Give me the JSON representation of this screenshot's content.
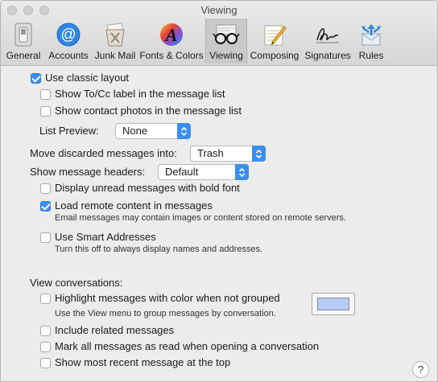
{
  "window": {
    "title": "Viewing"
  },
  "toolbar": {
    "items": [
      {
        "label": "General",
        "icon": "general-switch-icon"
      },
      {
        "label": "Accounts",
        "icon": "at-sign-icon"
      },
      {
        "label": "Junk Mail",
        "icon": "trash-bin-icon"
      },
      {
        "label": "Fonts & Colors",
        "icon": "fonts-colors-icon"
      },
      {
        "label": "Viewing",
        "icon": "eyeglasses-icon",
        "selected": true
      },
      {
        "label": "Composing",
        "icon": "pencil-paper-icon"
      },
      {
        "label": "Signatures",
        "icon": "signature-icon"
      },
      {
        "label": "Rules",
        "icon": "rules-arrows-icon"
      }
    ]
  },
  "layout_section": {
    "use_classic_layout": {
      "label": "Use classic layout",
      "checked": true
    },
    "show_tocc": {
      "label": "Show To/Cc label in the message list",
      "checked": false
    },
    "show_contact_photos": {
      "label": "Show contact photos in the message list",
      "checked": false
    },
    "list_preview": {
      "label": "List Preview:",
      "value": "None"
    }
  },
  "move_discarded": {
    "label": "Move discarded messages into:",
    "value": "Trash"
  },
  "message_headers": {
    "label": "Show message headers:",
    "value": "Default"
  },
  "bold_unread": {
    "label": "Display unread messages with bold font",
    "checked": false
  },
  "remote_content": {
    "label": "Load remote content in messages",
    "checked": true,
    "help": "Email messages may contain images or content stored on remote servers."
  },
  "smart_addresses": {
    "label": "Use Smart Addresses",
    "checked": false,
    "help": "Turn this off to always display names and addresses."
  },
  "conversations": {
    "heading": "View conversations:",
    "highlight": {
      "label": "Highlight messages with color when not grouped",
      "checked": false,
      "help": "Use the View menu to group messages by conversation.",
      "color": "#b3cdf7"
    },
    "include_related": {
      "label": "Include related messages",
      "checked": false
    },
    "mark_all_read": {
      "label": "Mark all messages as read when opening a conversation",
      "checked": false
    },
    "most_recent_top": {
      "label": "Show most recent message at the top",
      "checked": false
    }
  },
  "help_button": {
    "label": "?"
  },
  "colors": {
    "accent": "#3b8ef0"
  }
}
